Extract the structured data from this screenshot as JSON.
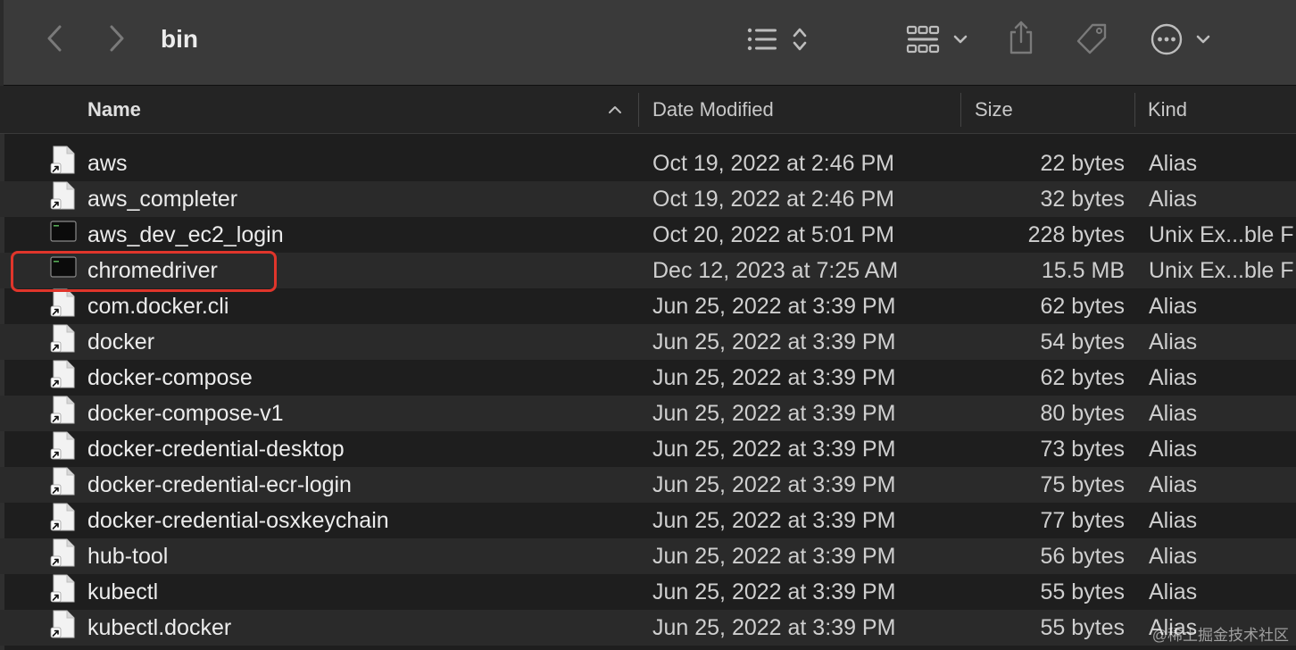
{
  "window": {
    "title": "bin"
  },
  "toolbar": {
    "icons": [
      "back-chevron-icon",
      "forward-chevron-icon",
      "list-view-icon",
      "sort-updown-icon",
      "grid-view-icon",
      "chevron-down-icon",
      "share-icon",
      "tag-icon",
      "more-ellipsis-icon",
      "chevron-down-icon"
    ]
  },
  "columns": {
    "name": "Name",
    "date": "Date Modified",
    "size": "Size",
    "kind": "Kind",
    "sort_indicator": "^"
  },
  "files": [
    {
      "name": "aws",
      "date": "Oct 19, 2022 at 2:46 PM",
      "size": "22 bytes",
      "kind": "Alias",
      "icon": "alias-document-icon"
    },
    {
      "name": "aws_completer",
      "date": "Oct 19, 2022 at 2:46 PM",
      "size": "32 bytes",
      "kind": "Alias",
      "icon": "alias-document-icon"
    },
    {
      "name": "aws_dev_ec2_login",
      "date": "Oct 20, 2022 at 5:01 PM",
      "size": "228 bytes",
      "kind": "Unix Ex...ble F",
      "icon": "terminal-executable-icon"
    },
    {
      "name": "chromedriver",
      "date": "Dec 12, 2023 at 7:25 AM",
      "size": "15.5 MB",
      "kind": "Unix Ex...ble F",
      "icon": "terminal-executable-icon"
    },
    {
      "name": "com.docker.cli",
      "date": "Jun 25, 2022 at 3:39 PM",
      "size": "62 bytes",
      "kind": "Alias",
      "icon": "alias-document-icon"
    },
    {
      "name": "docker",
      "date": "Jun 25, 2022 at 3:39 PM",
      "size": "54 bytes",
      "kind": "Alias",
      "icon": "alias-document-icon"
    },
    {
      "name": "docker-compose",
      "date": "Jun 25, 2022 at 3:39 PM",
      "size": "62 bytes",
      "kind": "Alias",
      "icon": "alias-document-icon"
    },
    {
      "name": "docker-compose-v1",
      "date": "Jun 25, 2022 at 3:39 PM",
      "size": "80 bytes",
      "kind": "Alias",
      "icon": "alias-document-icon"
    },
    {
      "name": "docker-credential-desktop",
      "date": "Jun 25, 2022 at 3:39 PM",
      "size": "73 bytes",
      "kind": "Alias",
      "icon": "alias-document-icon"
    },
    {
      "name": "docker-credential-ecr-login",
      "date": "Jun 25, 2022 at 3:39 PM",
      "size": "75 bytes",
      "kind": "Alias",
      "icon": "alias-document-icon"
    },
    {
      "name": "docker-credential-osxkeychain",
      "date": "Jun 25, 2022 at 3:39 PM",
      "size": "77 bytes",
      "kind": "Alias",
      "icon": "alias-document-icon"
    },
    {
      "name": "hub-tool",
      "date": "Jun 25, 2022 at 3:39 PM",
      "size": "56 bytes",
      "kind": "Alias",
      "icon": "alias-document-icon"
    },
    {
      "name": "kubectl",
      "date": "Jun 25, 2022 at 3:39 PM",
      "size": "55 bytes",
      "kind": "Alias",
      "icon": "alias-document-icon"
    },
    {
      "name": "kubectl.docker",
      "date": "Jun 25, 2022 at 3:39 PM",
      "size": "55 bytes",
      "kind": "Alias",
      "icon": "alias-document-icon"
    }
  ],
  "highlighted_file": "chromedriver",
  "colors": {
    "highlight_border": "#e0352b",
    "toolbar_bg": "#3a3a3a",
    "list_bg": "#1e1e1e",
    "alt_row_bg": "#2a2a2a"
  },
  "watermark": "@稀土掘金技术社区"
}
